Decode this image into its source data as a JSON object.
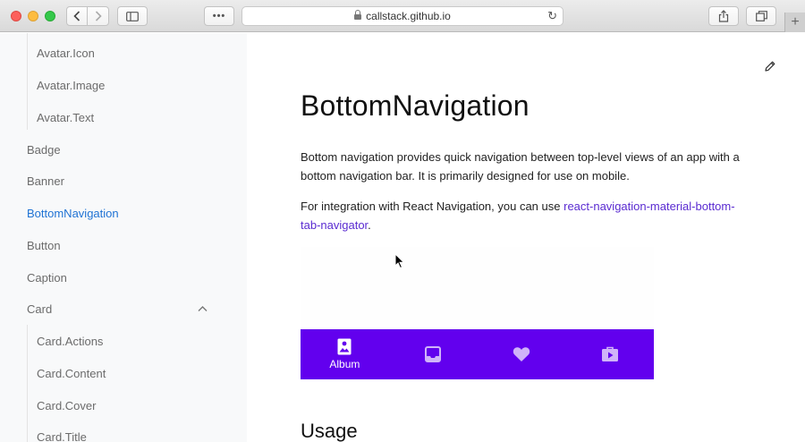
{
  "browser": {
    "url": "callstack.github.io",
    "dots_label": "•••",
    "plus_label": "+"
  },
  "sidebar": {
    "items": [
      {
        "label": "Avatar.Icon",
        "level": "sub"
      },
      {
        "label": "Avatar.Image",
        "level": "sub"
      },
      {
        "label": "Avatar.Text",
        "level": "sub"
      },
      {
        "label": "Badge",
        "level": "top"
      },
      {
        "label": "Banner",
        "level": "top"
      },
      {
        "label": "BottomNavigation",
        "level": "top",
        "active": true
      },
      {
        "label": "Button",
        "level": "top"
      },
      {
        "label": "Caption",
        "level": "top"
      },
      {
        "label": "Card",
        "level": "top",
        "expanded": true
      },
      {
        "label": "Card.Actions",
        "level": "sub"
      },
      {
        "label": "Card.Content",
        "level": "sub"
      },
      {
        "label": "Card.Cover",
        "level": "sub"
      },
      {
        "label": "Card.Title",
        "level": "sub"
      }
    ]
  },
  "main": {
    "title": "BottomNavigation",
    "intro": "Bottom navigation provides quick navigation between top-level views of an app with a bottom navigation bar. It is primarily designed for use on mobile.",
    "integration_prefix": "For integration with React Navigation, you can use ",
    "integration_link": "react-navigation-material-bottom-tab-navigator",
    "integration_suffix": ".",
    "usage_heading": "Usage"
  },
  "demo": {
    "bar_color": "#6200ee",
    "tabs": [
      {
        "icon": "image-album-icon",
        "label": "Album"
      },
      {
        "icon": "inbox-icon",
        "label": ""
      },
      {
        "icon": "heart-icon",
        "label": ""
      },
      {
        "icon": "video-bag-icon",
        "label": ""
      }
    ]
  },
  "colors": {
    "accent": "#1f73d4",
    "link": "#5a2bd1",
    "sidebar_bg": "#f8f9fa"
  }
}
